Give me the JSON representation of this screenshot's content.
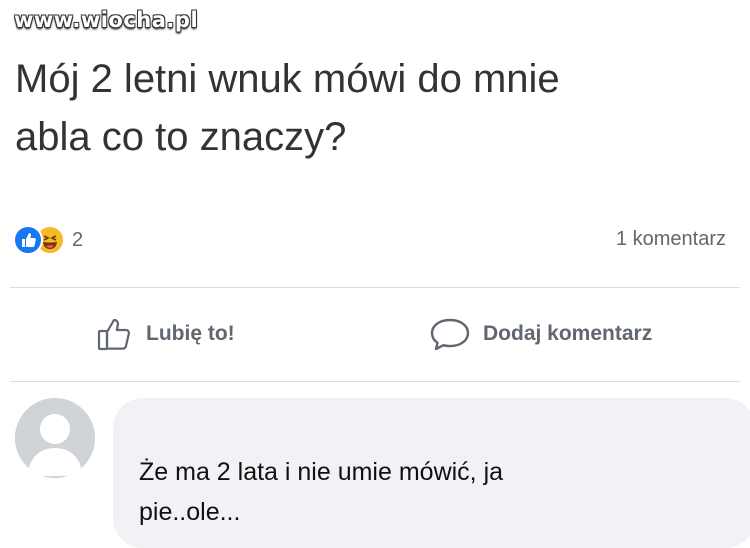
{
  "watermark": "www.wiocha.pl",
  "post": {
    "text_line1": "Mój 2 letni wnuk mówi do mnie",
    "text_line2": "abla co to znaczy?"
  },
  "reactions": {
    "icons": [
      "like-icon",
      "haha-icon"
    ],
    "count": "2"
  },
  "comment_count": "1 komentarz",
  "actions": {
    "like_label": "Lubię to!",
    "comment_label": "Dodaj komentarz"
  },
  "comment": {
    "author": "",
    "text_line1": "Że ma 2 lata i nie umie mówić, ja",
    "text_line2": "pie..ole..."
  },
  "colors": {
    "accent": "#1877f2",
    "haha": "#f7b928",
    "muted_text": "#606770",
    "divider": "#dadde1",
    "bubble_bg": "#f0f2f5"
  }
}
